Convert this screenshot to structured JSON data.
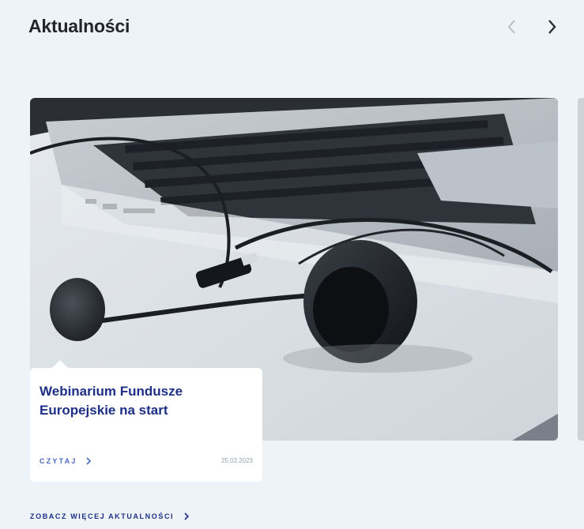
{
  "section": {
    "title": "Aktualności"
  },
  "carousel": {
    "prev_icon": "chevron-left-icon",
    "next_icon": "chevron-right-icon",
    "prev_color": "#b9bec8",
    "next_color": "#2a2d36"
  },
  "article": {
    "image_icon": "laptop-headset-photo",
    "title": "Webinarium Fundusze Europejskie na start",
    "read_label": "CZYTAJ",
    "date": "25.03.2023"
  },
  "footer": {
    "more_label": "ZOBACZ WIĘCEJ AKTUALNOŚCI"
  },
  "colors": {
    "background": "#eef3f8",
    "accent": "#1d2f86",
    "link": "#4a6ac4"
  }
}
